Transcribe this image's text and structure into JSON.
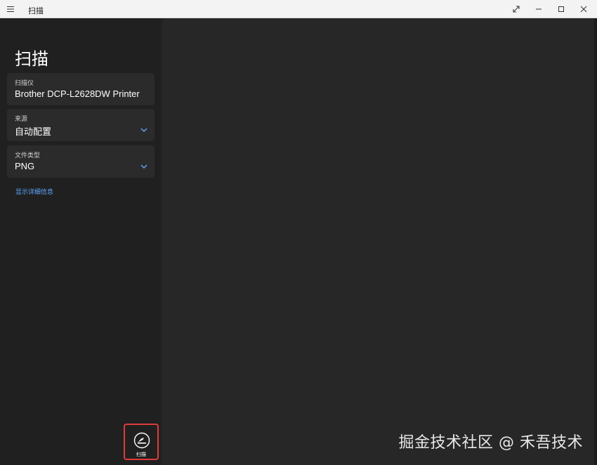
{
  "window": {
    "title": "扫描",
    "controls": [
      "expand-icon",
      "minimize-icon",
      "maximize-icon",
      "close-icon"
    ]
  },
  "left_pane": {
    "app_title": "扫描",
    "scanner": {
      "label": "扫描仪",
      "value": "Brother DCP-L2628DW Printer"
    },
    "source": {
      "label": "来源",
      "value": "自动配置"
    },
    "file_type": {
      "label": "文件类型",
      "value": "PNG"
    },
    "details_link": "显示详细信息",
    "scan_button_label": "扫描"
  },
  "watermark": "掘金技术社区 @ 禾吾技术",
  "colors": {
    "accent": "#5ea8ff",
    "highlight_border": "#e03a3a",
    "background": "#202020",
    "preview": "#272727"
  }
}
